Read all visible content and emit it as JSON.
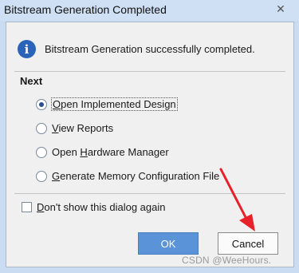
{
  "window": {
    "title": "Bitstream Generation Completed",
    "close_glyph": "✕"
  },
  "message": {
    "icon_glyph": "i",
    "text": "Bitstream Generation successfully completed."
  },
  "next": {
    "heading": "Next",
    "selected_index": 0,
    "options": [
      {
        "mnemonic": "O",
        "rest": "pen Implemented Design"
      },
      {
        "mnemonic": "V",
        "rest": "iew Reports"
      },
      {
        "prefix": "Open ",
        "mnemonic": "H",
        "rest": "ardware Manager"
      },
      {
        "mnemonic": "G",
        "rest": "enerate Memory Configuration File"
      }
    ]
  },
  "dont_show": {
    "mnemonic": "D",
    "rest": "on't show this dialog again",
    "checked": false
  },
  "buttons": {
    "ok": "OK",
    "cancel": "Cancel"
  },
  "watermark": "CSDN @WeeHours.",
  "colors": {
    "info_icon": "#2b63b8",
    "ok_button": "#5a93d8",
    "annotation_arrow": "#e8202a"
  }
}
